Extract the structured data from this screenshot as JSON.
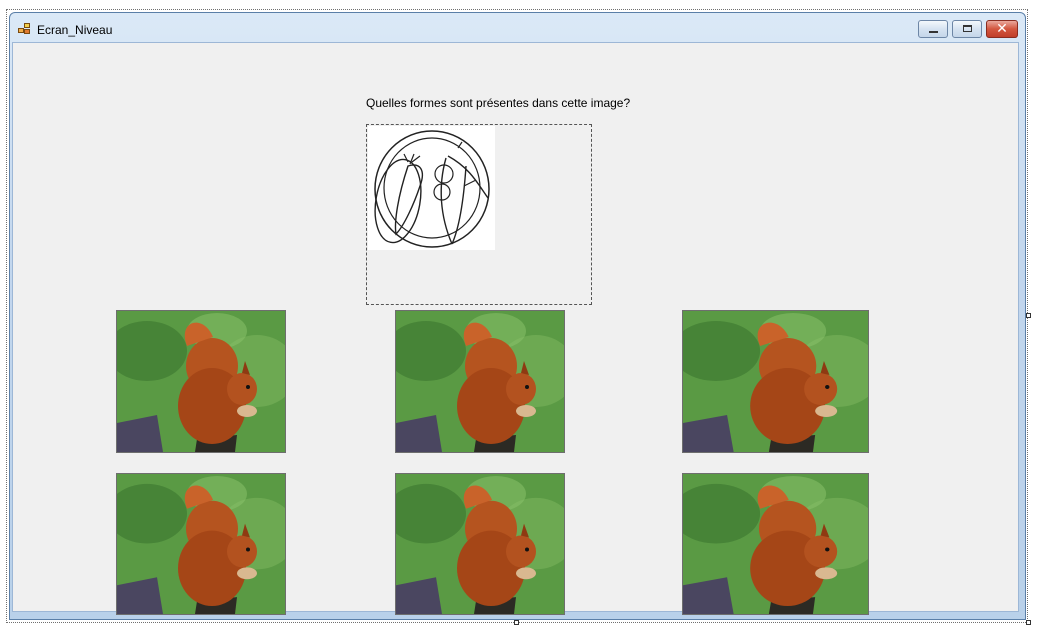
{
  "window": {
    "title": "Ecran_Niveau",
    "controls": {
      "minimize_icon": "minimize-icon",
      "maximize_icon": "maximize-icon",
      "close_icon": "close-icon"
    }
  },
  "question": {
    "text": "Quelles formes sont présentes dans cette image?"
  },
  "question_image": {
    "icon": "fruit-vegetable-shapes-sketch"
  },
  "answers": [
    {
      "image": "squirrel-photo"
    },
    {
      "image": "squirrel-photo"
    },
    {
      "image": "squirrel-photo"
    },
    {
      "image": "squirrel-photo"
    },
    {
      "image": "squirrel-photo"
    },
    {
      "image": "squirrel-photo"
    }
  ],
  "colors": {
    "titlebar": "#c3d7ee",
    "client_background": "#f0f0f0",
    "close_button": "#c03e2a"
  }
}
